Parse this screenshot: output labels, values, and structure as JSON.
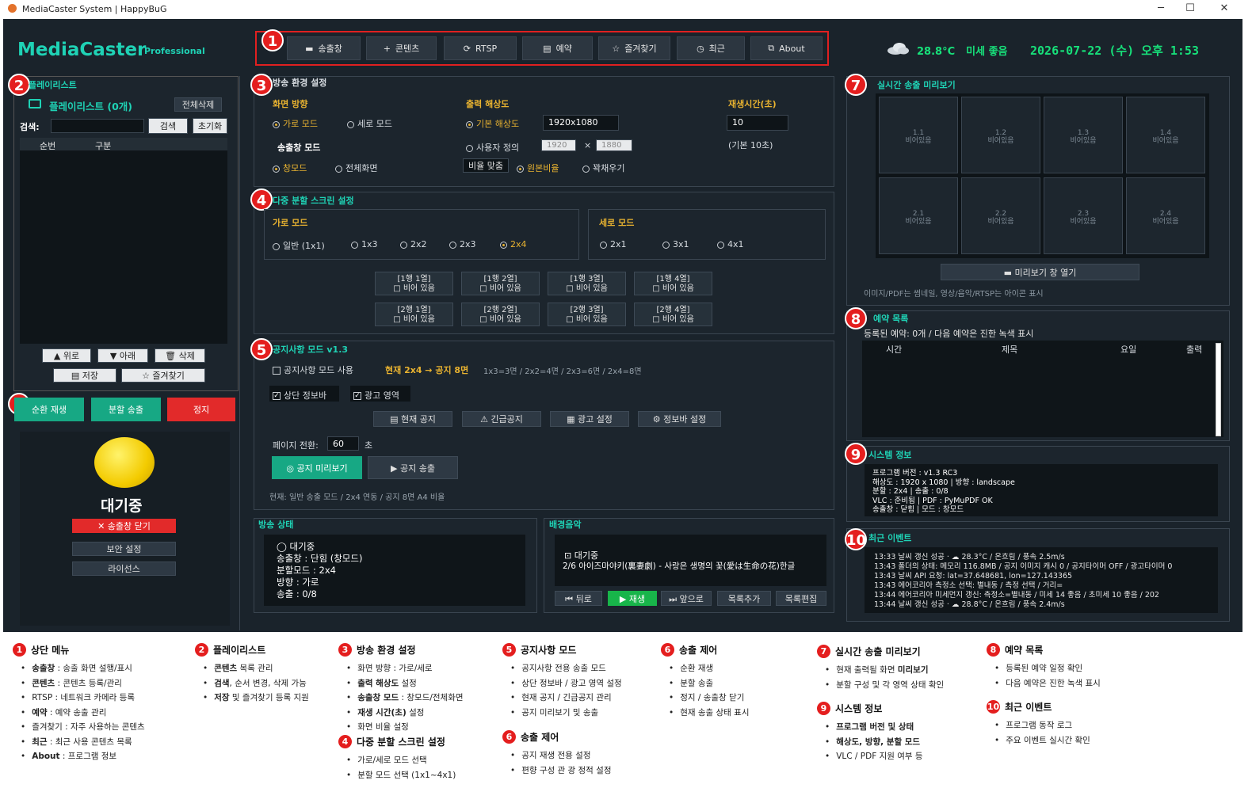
{
  "window": {
    "title": "MediaCaster System | HappyBuG",
    "min": "─",
    "max": "☐",
    "close": "✕"
  },
  "brand": {
    "name": "MediaCaster",
    "edition": "Professional"
  },
  "menu": [
    {
      "icon": "▬",
      "label": "송출창"
    },
    {
      "icon": "+",
      "label": "콘텐츠"
    },
    {
      "icon": "⟳",
      "label": "RTSP"
    },
    {
      "icon": "▤",
      "label": "예약"
    },
    {
      "icon": "☆",
      "label": "즐겨찾기"
    },
    {
      "icon": "◷",
      "label": "최근"
    },
    {
      "icon": "⧉",
      "label": "About"
    }
  ],
  "status": {
    "weather_icon": "cloud-icon",
    "temp": "28.8°C",
    "dust": "미세 좋음",
    "datetime": "2026-07-22 (수) 오후 1:53"
  },
  "badges": [
    "1",
    "2",
    "3",
    "4",
    "5",
    "6",
    "7",
    "8",
    "9",
    "10"
  ],
  "playlist": {
    "title": "플레이리스트",
    "folder": "플레이리스트 (0개)",
    "clear_all": "전체삭제",
    "search_label": "검색:",
    "search_btn": "검색",
    "reset_btn": "초기화",
    "col_order": "순번",
    "col_type": "구분",
    "up": "▲ 위로",
    "down": "▼ 아래",
    "delete": "🗑 삭제",
    "save": "▤ 저장",
    "fav": "☆ 즐겨찾기"
  },
  "control": {
    "loop": "순환 재생",
    "split": "분할 송출",
    "stop": "정지",
    "state": "대기중",
    "close_window": "✕ 송출창 닫기",
    "security": "보안 설정",
    "license": "라이선스"
  },
  "broadcast": {
    "title": "방송 환경 설정",
    "orientation": "화면 방향",
    "landscape": "가로 모드",
    "portrait": "세로 모드",
    "window_mode_title": "송출창 모드",
    "window_mode": "창모드",
    "fullscreen": "전체화면",
    "resolution": "출력 해상도",
    "res_default": "기본 해상도",
    "res_value": "1920x1080",
    "res_custom": "사용자 정의",
    "w": "1920",
    "x": "×",
    "h": "1880",
    "ratio_fit": "비율 맞춤",
    "ratio_orig": "원본비율",
    "stretch": "꽉채우기",
    "playtime": "재생시간(초)",
    "playtime_val": "10",
    "playtime_hint": "(기본 10초)"
  },
  "multi": {
    "title": "다중 분할 스크린 설정",
    "landscape": "가로 모드",
    "portrait": "세로 모드",
    "l_opts": [
      "일반 (1x1)",
      "1x3",
      "2x2",
      "2x3",
      "2x4"
    ],
    "p_opts": [
      "2x1",
      "3x1",
      "4x1"
    ],
    "cells": [
      [
        "[1행 1열]",
        "□ 비어 있음"
      ],
      [
        "[1행 2열]",
        "□ 비어 있음"
      ],
      [
        "[1행 3열]",
        "□ 비어 있음"
      ],
      [
        "[1행 4열]",
        "□ 비어 있음"
      ],
      [
        "[2행 1열]",
        "□ 비어 있음"
      ],
      [
        "[2행 2열]",
        "□ 비어 있음"
      ],
      [
        "[2행 3열]",
        "□ 비어 있음"
      ],
      [
        "[2행 4열]",
        "□ 비어 있음"
      ]
    ]
  },
  "notice": {
    "title": "공지사항 모드 v1.3",
    "use": "공지사항 모드 사용",
    "current": "현재 2x4 → 공지 8면",
    "map": "1x3=3면 / 2x2=4면 / 2x3=6면 / 2x4=8면",
    "topbar": "상단 정보바",
    "ad": "광고 영역",
    "btns": [
      "▤ 현재 공지",
      "⚠ 긴급공지",
      "▦ 광고 설정",
      "⚙ 정보바 설정"
    ],
    "page_label": "페이지 전환:",
    "page_val": "60",
    "page_unit": "초",
    "preview": "◎ 공지 미리보기",
    "send": "▶ 공지 송출",
    "footer": "현재: 일반 송출 모드 / 2x4 연동 / 공지 8면 A4 비율"
  },
  "bstate": {
    "title": "방송 상태",
    "lines": [
      "◯  대기중",
      "송출창 : 단힘 (창모드)",
      "분할모드 : 2x4",
      "방향 : 가로",
      "송출 : 0/8"
    ]
  },
  "bgm": {
    "title": "배경음악",
    "state": "⊡ 대기중",
    "track": "2/6 아이즈마야키(裏妻劇) - 사랑은 생명의 꽃(愛は生命の花)한글",
    "back": "⏮ 뒤로",
    "play": "▶ 재생",
    "fwd": "⏭ 앞으로",
    "add": "목록추가",
    "edit": "목록편집"
  },
  "preview": {
    "title": "실시간 송출 미리보기",
    "cells": [
      [
        "1.1",
        "비어있음"
      ],
      [
        "1.2",
        "비어있음"
      ],
      [
        "1.3",
        "비어있음"
      ],
      [
        "1.4",
        "비어있음"
      ],
      [
        "2.1",
        "비어있음"
      ],
      [
        "2.2",
        "비어있음"
      ],
      [
        "2.3",
        "비어있음"
      ],
      [
        "2.4",
        "비어있음"
      ]
    ],
    "open": "▬ 미리보기 창 열기",
    "hint": "이미지/PDF는 썸네일, 영상/음악/RTSP는 아이콘 표시"
  },
  "reserve": {
    "title": "예약 목록",
    "info": "등록된 예약: 0개 / 다음 예약은 진한 녹색 표시",
    "cols": [
      "시간",
      "제목",
      "요일",
      "출력"
    ]
  },
  "sysinfo": {
    "title": "시스템 정보",
    "lines": [
      "프로그램 버전 : v1.3 RC3",
      "해상도 : 1920 x 1080   |   방향 : landscape",
      "분할 : 2x4   |   송출 : 0/8",
      "VLC : 준비됨   |   PDF : PyMuPDF OK",
      "송출창 : 닫힘   |   모드 : 창모드"
    ]
  },
  "events": {
    "title": "최근 이벤트",
    "lines": [
      "13:33  날씨 갱신 성공 · ☁ 28.3°C / 온흐림 / 풍속 2.5m/s",
      "13:43  폴더의 상태: 메모리 116.8MB / 공지 이미지 캐시 0 / 공지타이머 OFF / 광고타이머 0",
      "13:43  날씨 API 요청: lat=37.648681, lon=127.143365",
      "13:43  에어코리아 측정소 선택: 별내동 / 측정 선택 / 거리=",
      "13:44  에어코리아 미세먼지 갱신: 측정소=별내동 / 미세 14 좋음 / 초미세 10 좋음 / 202",
      "13:44  날씨 갱신 성공 · ☁ 28.8°C / 온흐림 / 풍속 2.4m/s"
    ]
  },
  "legend": [
    {
      "n": "1",
      "title": "상단 메뉴",
      "items": [
        "**송출창** : 송출 화면 설행/표시",
        "**콘텐츠** : 콘텐츠 등록/관리",
        "RTSP : 네트워크 카메라 등록",
        "**예약** : 예약 송출 관리",
        "즐겨찾기 : 자주 사용하는 콘텐츠",
        "**최근** : 최근 사용 콘텐츠 목록",
        "**About** : 프로그램 정보"
      ]
    },
    {
      "n": "2",
      "title": "플레이리스트",
      "items": [
        "**콘텐츠** 목록 관리",
        "**검색**, 순서 변경, 삭제 가능",
        "**저장** 및 즐겨찾기 등록 지원"
      ]
    },
    {
      "n": "3",
      "title": "방송 환경 설정",
      "items": [
        "화면 방향 : 가로/세로",
        "**출력 해상도** 설정",
        "**송출창 모드** : 창모드/전체화면",
        "**재생 시간(초)** 설정",
        "화면 비율 설정"
      ]
    },
    {
      "n": "4",
      "title": "다중 분할 스크린 설정",
      "items": [
        "가로/세로 모드 선택",
        "분할 모드 선택 (1x1~4x1)"
      ]
    },
    {
      "n": "5",
      "title": "공지사항 모드",
      "items": [
        "공지사항 전용 송출 모드",
        "상단 정보바 / 광고 영역 설정",
        "현재 공지 / 긴급공지 관리",
        "공지 미리보기 및 송출"
      ]
    },
    {
      "n": "6",
      "title": "송출 제어",
      "items": [
        "공지 재생 전용 설정",
        "편향 구성 관 광 정적 설정"
      ]
    },
    {
      "n": "6",
      "title": "송출 제어",
      "items": [
        "순환 재생",
        "분할 송출",
        "정지 / 송출창 닫기",
        "현재 송출 상태 표시"
      ]
    },
    {
      "n": "7",
      "title": "실시간 송출 미리보기",
      "items": [
        "현재 출력될 화면 **미리보기**",
        "분할 구성 및 각 영역 상태 확인"
      ]
    },
    {
      "n": "9",
      "title": "시스템 정보",
      "items": [
        "**프로그램 버전 및 상태**",
        "**해상도, 방향, 분할 모드**",
        "VLC / PDF 지원 여부 등"
      ]
    },
    {
      "n": "8",
      "title": "예약 목록",
      "items": [
        "등록된 예약 일정 확인",
        "다음 예약은 진한 녹색 표시"
      ]
    },
    {
      "n": "10",
      "title": "최근 이벤트",
      "items": [
        "프로그램 동작 로그",
        "주요 이벤트 실시간 확인"
      ]
    }
  ]
}
